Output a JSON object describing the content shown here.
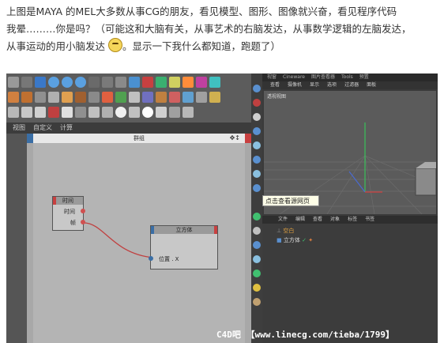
{
  "post": {
    "line1": "上图是MAYA 的MEL大多数从事CG的朋友，看见模型、图形、图像就兴奋，看见程序代码",
    "line2": "我晕………你是吗？（可能这和大脑有关，从事艺术的右脑发达，从事数学逻辑的左脑发达，",
    "line3a": "从事运动的用小脑发达",
    "line3b": "。显示一下我什么都知道，跑题了）"
  },
  "screenshot": {
    "bottom_menu": [
      "视图",
      "自定义",
      "计算"
    ],
    "xpresso_title": "群组",
    "node_time": {
      "title": "时间",
      "port_out1": "时间",
      "port_out2": "帧"
    },
    "node_cube": {
      "title": "立方体",
      "port_in": "位置 . X"
    },
    "viewport_tabs": [
      "视窗",
      "Cineware",
      "图片查看器",
      "Tools",
      "预置"
    ],
    "viewport_menu": [
      "查看",
      "摄像机",
      "显示",
      "选项",
      "过滤器",
      "面板"
    ],
    "viewport_label": "透视视图",
    "tooltip": "点击查看源网页",
    "object_tabs": [
      "文件",
      "编辑",
      "查看",
      "对象",
      "标签",
      "书签"
    ],
    "objects": [
      {
        "name": "空白"
      },
      {
        "name": "立方体"
      }
    ],
    "watermark": "C4D吧 【www.linecg.com/tieba/1799】"
  },
  "colors": {
    "accent_blue": "#3a6ea5",
    "accent_red": "#c84040",
    "wire": "#c04040"
  }
}
